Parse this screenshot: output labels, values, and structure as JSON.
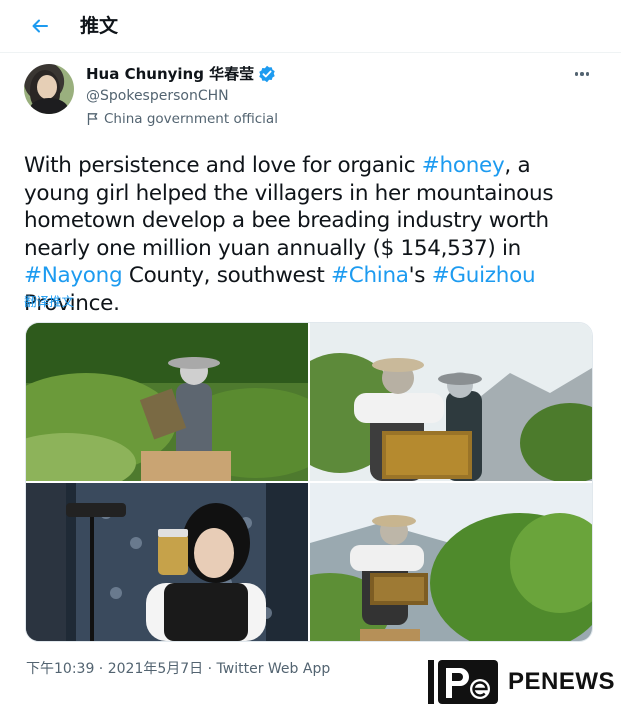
{
  "header": {
    "title": "推文"
  },
  "author": {
    "name": "Hua Chunying 华春莹",
    "handle": "@SpokespersonCHN",
    "label": "China government official"
  },
  "tweet": {
    "p1": "With persistence and love for organic ",
    "tag1": "#honey",
    "p2": ", a young girl helped the villagers in her mountainous hometown develop a bee breading industry worth nearly one million yuan annually ($ 154,537) in ",
    "tag2": "#Nayong",
    "p3": " County, southwest ",
    "tag3": "#China",
    "p4": "'s ",
    "tag4": "#Guizhou",
    "p5": " Province.",
    "translate": "翻译推文"
  },
  "media": {
    "photos": [
      {
        "alt_icon": "beekeeper-forest-photo"
      },
      {
        "alt_icon": "two-beekeepers-mountain-photo"
      },
      {
        "alt_icon": "woman-honey-jar-photo"
      },
      {
        "alt_icon": "beekeeper-hive-frame-photo"
      }
    ]
  },
  "footer": {
    "time": "下午10:39",
    "sep1": " · ",
    "date": "2021年5月7日",
    "sep2": " · ",
    "via": "Twitter Web App"
  },
  "watermark": {
    "logo_letter": "P",
    "logo_mark": "e",
    "text": "PENEWS"
  },
  "colors": {
    "link": "#1d9bf0",
    "muted": "#536471",
    "text": "#0f1419"
  }
}
